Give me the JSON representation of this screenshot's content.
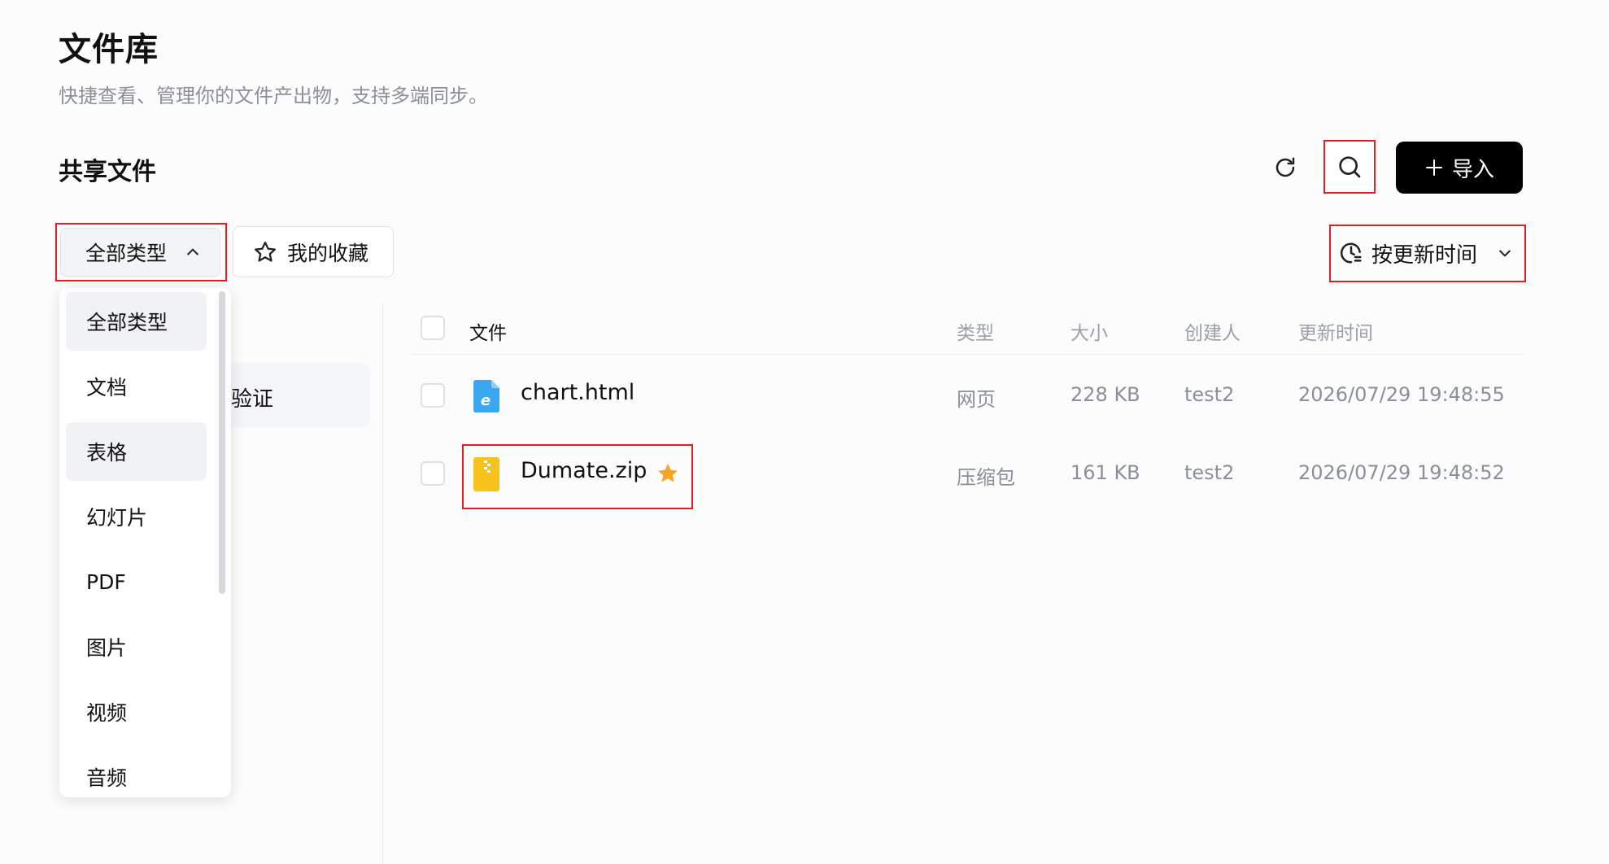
{
  "page": {
    "title": "文件库",
    "subtitle": "快捷查看、管理你的文件产出物，支持多端同步。",
    "section_title": "共享文件"
  },
  "toolbar": {
    "refresh_icon": "refresh-icon",
    "search_icon": "search-icon",
    "import_label": "导入"
  },
  "filters": {
    "type_filter_label": "全部类型",
    "favorites_label": "我的收藏",
    "sort_label": "按更新时间"
  },
  "dropdown": {
    "items": [
      "全部类型",
      "文档",
      "表格",
      "幻灯片",
      "PDF",
      "图片",
      "视频",
      "音频"
    ]
  },
  "left_panel": {
    "partial_label": "验证"
  },
  "table": {
    "headers": {
      "file": "文件",
      "type": "类型",
      "size": "大小",
      "creator": "创建人",
      "updated": "更新时间"
    },
    "rows": [
      {
        "name": "chart.html",
        "type": "网页",
        "size": "228 KB",
        "creator": "test2",
        "updated": "2026/07/29 19:48:55",
        "icon": "html-file-icon",
        "favorited": false
      },
      {
        "name": "Dumate.zip",
        "type": "压缩包",
        "size": "161 KB",
        "creator": "test2",
        "updated": "2026/07/29 19:48:52",
        "icon": "zip-file-icon",
        "favorited": true
      }
    ]
  },
  "colors": {
    "highlight_border": "#e02020",
    "star": "#f5a623",
    "zip_icon": "#f8c21c",
    "html_icon": "#3aa7f0"
  }
}
